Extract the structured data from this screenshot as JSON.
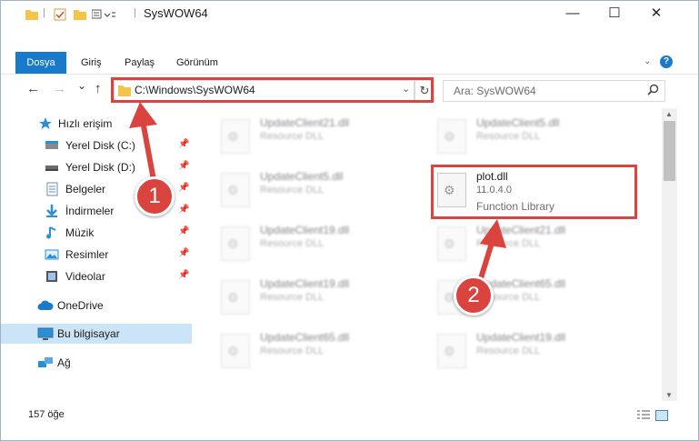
{
  "window": {
    "title": "SysWOW64",
    "minimize": "—",
    "maximize": "☐",
    "close": "✕"
  },
  "ribbon": {
    "tabs": [
      "Dosya",
      "Giriş",
      "Paylaş",
      "Görünüm"
    ],
    "help": "?"
  },
  "nav": {
    "back": "←",
    "forward": "→",
    "recent": "⌄",
    "up": "↑",
    "address": "C:\\Windows\\SysWOW64",
    "refresh": "↻",
    "search_placeholder": "Ara: SysWOW64"
  },
  "sidebar": {
    "quick_access": "Hızlı erişim",
    "items": [
      {
        "label": "Yerel Disk (C:)",
        "pinned": true
      },
      {
        "label": "Yerel Disk (D:)",
        "pinned": true
      },
      {
        "label": "Belgeler",
        "pinned": true
      },
      {
        "label": "İndirmeler",
        "pinned": true
      },
      {
        "label": "Müzik",
        "pinned": true
      },
      {
        "label": "Resimler",
        "pinned": true
      },
      {
        "label": "Videolar",
        "pinned": true
      }
    ],
    "onedrive": "OneDrive",
    "this_pc": "Bu bilgisayar",
    "network": "Ağ"
  },
  "files": {
    "left": [
      {
        "name": "UpdateClient21.dll",
        "type": "Resource DLL"
      },
      {
        "name": "UpdateClient5.dll",
        "type": "Resource DLL"
      },
      {
        "name": "UpdateClient19.dll",
        "type": "Resource DLL"
      },
      {
        "name": "UpdateClient19.dll",
        "type": "Resource DLL"
      },
      {
        "name": "UpdateClient65.dll",
        "type": "Resource DLL"
      }
    ],
    "right": [
      {
        "name": "UpdateClient5.dll",
        "type": "Resource DLL"
      },
      {
        "name": "UpdateClient21.dll",
        "type": "Resource DLL"
      },
      {
        "name": "UpdateClient65.dll",
        "type": "Resource DLL"
      },
      {
        "name": "UpdateClient19.dll",
        "type": "Resource DLL"
      }
    ],
    "plot": {
      "name": "plot.dll",
      "version": "11.0.4.0",
      "type": "Function Library"
    }
  },
  "status": {
    "count": "157 öğe"
  },
  "annotations": {
    "step1": "1",
    "step2": "2",
    "color": "#d9443f"
  }
}
